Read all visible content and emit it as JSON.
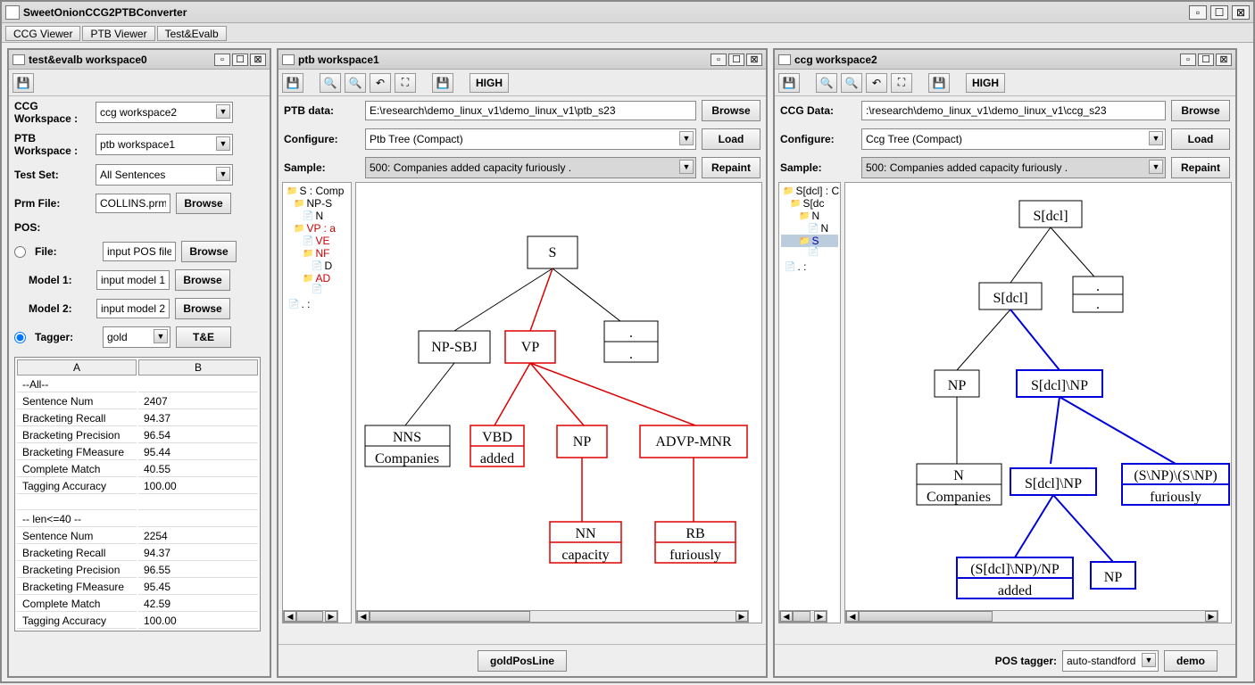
{
  "window": {
    "title": "SweetOnionCCG2PTBConverter"
  },
  "main_tabs": {
    "ccg": "CCG Viewer",
    "ptb": "PTB Viewer",
    "te": "Test&Evalb"
  },
  "evalb": {
    "title": "test&evalb workspace0",
    "labels": {
      "ccg": "CCG Workspace :",
      "ptb": "PTB Workspace :",
      "testset": "Test Set:",
      "prm": "Prm File:",
      "pos": "POS:",
      "file": "File:",
      "model1": "Model 1:",
      "model2": "Model 2:",
      "tagger": "Tagger:",
      "browse": "Browse",
      "te": "T&E"
    },
    "values": {
      "ccg": "ccg workspace2",
      "ptb": "ptb workspace1",
      "testset": "All Sentences",
      "prm": "COLLINS.prm",
      "posfile": "input POS file",
      "model1": "input model 1",
      "model2": "input model 2",
      "tagger": "gold"
    },
    "table": {
      "colA": "A",
      "colB": "B",
      "rows": [
        {
          "a": "--All--",
          "b": ""
        },
        {
          "a": "Sentence Num",
          "b": "2407"
        },
        {
          "a": "Bracketing Recall",
          "b": "94.37"
        },
        {
          "a": "Bracketing Precision",
          "b": "96.54"
        },
        {
          "a": "Bracketing FMeasure",
          "b": "95.44"
        },
        {
          "a": "Complete Match",
          "b": "40.55"
        },
        {
          "a": "Tagging Accuracy",
          "b": "100.00"
        },
        {
          "a": "",
          "b": ""
        },
        {
          "a": "-- len<=40 --",
          "b": ""
        },
        {
          "a": "Sentence Num",
          "b": "2254"
        },
        {
          "a": "Bracketing Recall",
          "b": "94.37"
        },
        {
          "a": "Bracketing Precision",
          "b": "96.55"
        },
        {
          "a": "Bracketing FMeasure",
          "b": "95.45"
        },
        {
          "a": "Complete Match",
          "b": "42.59"
        },
        {
          "a": "Tagging Accuracy",
          "b": "100.00"
        }
      ]
    }
  },
  "ptb": {
    "title": "ptb workspace1",
    "high": "HIGH",
    "labels": {
      "ptbdata": "PTB data:",
      "configure": "Configure:",
      "sample": "Sample:",
      "browse": "Browse",
      "load": "Load",
      "repaint": "Repaint"
    },
    "values": {
      "ptbdata": "E:\\research\\demo_linux_v1\\demo_linux_v1\\ptb_s23",
      "configure": "Ptb Tree (Compact)",
      "sample": "500: Companies added capacity furiously ."
    },
    "outline": [
      "S : Comp",
      "NP-S",
      "N",
      "VP : a",
      "VE",
      "NF",
      "D",
      "AD",
      "",
      ". :"
    ],
    "goldposline": "goldPosLine",
    "tree": {
      "S": "S",
      "NPSBJ": "NP-SBJ",
      "VP": "VP",
      "dot": ".",
      "dot2": ".",
      "NNS": "NNS",
      "Companies": "Companies",
      "VBD": "VBD",
      "added": "added",
      "NP": "NP",
      "ADVPMNR": "ADVP-MNR",
      "NN": "NN",
      "capacity": "capacity",
      "RB": "RB",
      "furiously": "furiously"
    }
  },
  "ccg": {
    "title": "ccg workspace2",
    "high": "HIGH",
    "labels": {
      "ccgdata": "CCG Data:",
      "configure": "Configure:",
      "sample": "Sample:",
      "browse": "Browse",
      "load": "Load",
      "repaint": "Repaint",
      "postagger": "POS tagger:",
      "demo": "demo"
    },
    "values": {
      "ccgdata": ":\\research\\demo_linux_v1\\demo_linux_v1\\ccg_s23",
      "configure": "Ccg Tree (Compact)",
      "sample": "500: Companies added capacity furiously .",
      "postagger": "auto-standford"
    },
    "outline": [
      "S[dcl] : C",
      "S[dc",
      "N",
      "N",
      "S",
      "",
      ". :"
    ],
    "tree": {
      "Sdcl": "S[dcl]",
      "dot": ".",
      "dot2": ".",
      "Sdcl2": "S[dcl]",
      "NP": "NP",
      "SdclNP": "S[dcl]\\NP",
      "N": "N",
      "Companies": "Companies",
      "SdclNP2": "S[dcl]\\NP",
      "SNPSNP": "(S\\NP)\\(S\\NP)",
      "furiously": "furiously",
      "SdclNPNP": "(S[dcl]\\NP)/NP",
      "added": "added",
      "NP2": "NP"
    }
  }
}
